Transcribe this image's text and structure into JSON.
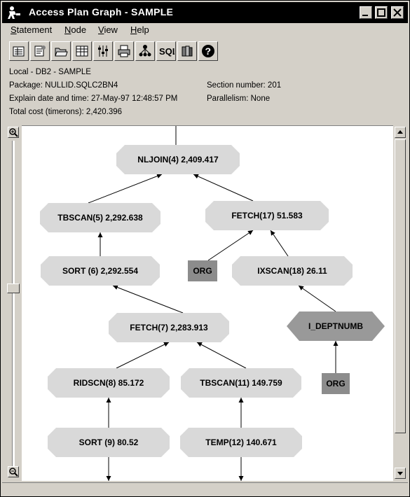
{
  "window": {
    "title": "Access Plan Graph - SAMPLE"
  },
  "menu": [
    {
      "key": "S",
      "rest": "tatement"
    },
    {
      "key": "N",
      "rest": "ode"
    },
    {
      "key": "V",
      "rest": "iew"
    },
    {
      "key": "H",
      "rest": "elp"
    }
  ],
  "toolbar": [
    "statistics-icon",
    "details-icon",
    "open-icon",
    "table-icon",
    "settings-icon",
    "print-icon",
    "tree-icon",
    "sql-icon",
    "books-icon",
    "help-icon"
  ],
  "toolbar_sql_text": "SQL",
  "info": {
    "location": "Local - DB2 - SAMPLE",
    "package": "Package: NULLID.SQLC2BN4",
    "section": "Section number: 201",
    "explain": "Explain date and time: 27-May-97 12:48:57 PM",
    "parallelism": "Parallelism: None",
    "cost": "Total cost (timerons): 2,420.396"
  },
  "graph": {
    "nodes": [
      {
        "id": "nljoin",
        "label": "NLJOIN(4) 2,409.417",
        "shape": "octagon"
      },
      {
        "id": "tbscan5",
        "label": "TBSCAN(5) 2,292.638",
        "shape": "octagon"
      },
      {
        "id": "fetch17",
        "label": "FETCH(17) 51.583",
        "shape": "octagon"
      },
      {
        "id": "sort6",
        "label": "SORT (6) 2,292.554",
        "shape": "octagon"
      },
      {
        "id": "org1",
        "label": "ORG",
        "shape": "rect"
      },
      {
        "id": "ixscan18",
        "label": "IXSCAN(18) 26.11",
        "shape": "octagon"
      },
      {
        "id": "fetch7",
        "label": "FETCH(7) 2,283.913",
        "shape": "octagon"
      },
      {
        "id": "ideptnumb",
        "label": "I_DEPTNUMB",
        "shape": "hexagon"
      },
      {
        "id": "ridscn8",
        "label": "RIDSCN(8) 85.172",
        "shape": "octagon"
      },
      {
        "id": "tbscan11",
        "label": "TBSCAN(11) 149.759",
        "shape": "octagon"
      },
      {
        "id": "org2",
        "label": "ORG",
        "shape": "rect"
      },
      {
        "id": "sort9",
        "label": "SORT (9) 80.52",
        "shape": "octagon"
      },
      {
        "id": "temp12",
        "label": "TEMP(12) 140.671",
        "shape": "octagon"
      }
    ],
    "edges": [
      [
        "tbscan5",
        "nljoin"
      ],
      [
        "fetch17",
        "nljoin"
      ],
      [
        "sort6",
        "tbscan5"
      ],
      [
        "org1",
        "fetch17"
      ],
      [
        "ixscan18",
        "fetch17"
      ],
      [
        "fetch7",
        "sort6"
      ],
      [
        "ideptnumb",
        "ixscan18"
      ],
      [
        "org2",
        "ideptnumb"
      ],
      [
        "ridscn8",
        "fetch7"
      ],
      [
        "tbscan11",
        "fetch7"
      ],
      [
        "sort9",
        "ridscn8"
      ],
      [
        "temp12",
        "tbscan11"
      ]
    ],
    "colors": {
      "octagon": "#d9d9d9",
      "rect": "#8c8c8c",
      "hexagon": "#999999",
      "line": "#000000"
    }
  }
}
